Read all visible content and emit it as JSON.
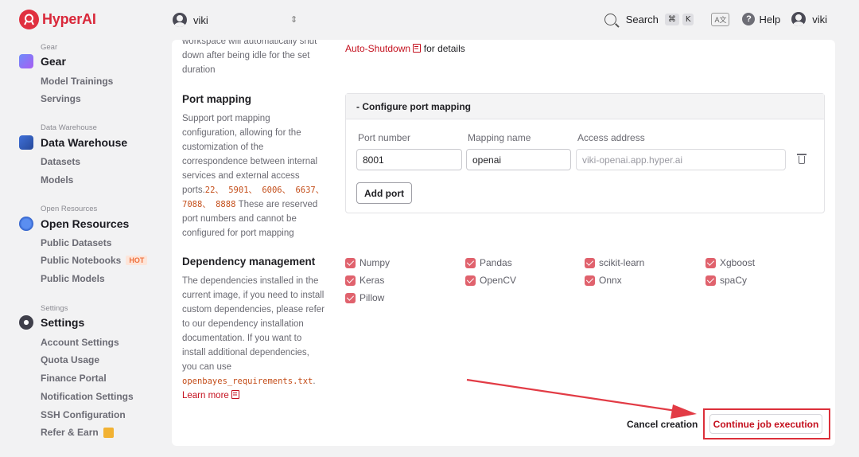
{
  "brand": {
    "name": "HyperAI",
    "color": "#d9283a"
  },
  "workspace": {
    "user": "viki"
  },
  "topbar": {
    "search_label": "Search",
    "shortcut_keys": [
      "⌘",
      "K"
    ],
    "lang_icon": "A文",
    "help_label": "Help",
    "user": "viki"
  },
  "sidebar": {
    "gear": {
      "caption": "Gear",
      "title": "Gear",
      "items": [
        "Model Trainings",
        "Servings"
      ]
    },
    "data_warehouse": {
      "caption": "Data Warehouse",
      "title": "Data Warehouse",
      "items": [
        "Datasets",
        "Models"
      ]
    },
    "open_resources": {
      "caption": "Open Resources",
      "title": "Open Resources",
      "items": [
        "Public Datasets",
        "Public Notebooks",
        "Public Models"
      ],
      "hot_badge": "HOT"
    },
    "settings": {
      "caption": "Settings",
      "title": "Settings",
      "items": [
        "Account Settings",
        "Quota Usage",
        "Finance Portal",
        "Notification Settings",
        "SSH Configuration",
        "Refer & Earn"
      ]
    }
  },
  "auto_shutdown": {
    "desc_lines": [
      "workspace will automatically shut",
      "down after being idle for the set",
      "duration"
    ],
    "link": "Auto-Shutdown",
    "suffix": " for details"
  },
  "port_mapping": {
    "title": "Port mapping",
    "desc_lines": [
      "Support port mapping",
      "configuration, allowing for the",
      "customization of the",
      "correspondence between internal",
      "services and external access"
    ],
    "desc_ports_prefix": "ports.",
    "reserved_ports_line1": "22、 5901、 6006、 6637、",
    "reserved_ports_line2": "7088、 8888",
    "desc_tail_line1": " These are reserved",
    "desc_tail_lines": [
      "port numbers and cannot be",
      "configured for port mapping"
    ],
    "box_header": "- Configure port mapping",
    "col_port": "Port number",
    "col_name": "Mapping name",
    "col_address": "Access address",
    "row": {
      "port": "8001",
      "name": "openai",
      "address": "viki-openai.app.hyper.ai"
    },
    "add_button": "Add port"
  },
  "dependency": {
    "title": "Dependency management",
    "desc_lines": [
      "The dependencies installed in the",
      "current image, if you need to install",
      "custom dependencies, please refer",
      "to our dependency installation",
      "documentation. If you want to",
      "install additional dependencies,",
      "you can use"
    ],
    "requirements_file": "openbayes_requirements.txt",
    "period": ".",
    "learn_more": "Learn more",
    "packages": [
      "Numpy",
      "Pandas",
      "scikit-learn",
      "Xgboost",
      "Keras",
      "OpenCV",
      "Onnx",
      "spaCy",
      "Pillow"
    ]
  },
  "footer": {
    "cancel": "Cancel creation",
    "continue": "Continue job execution"
  },
  "colors": {
    "accent": "#c4101e",
    "checkbox": "#e0626d",
    "highlight": "#dc2f3a"
  }
}
